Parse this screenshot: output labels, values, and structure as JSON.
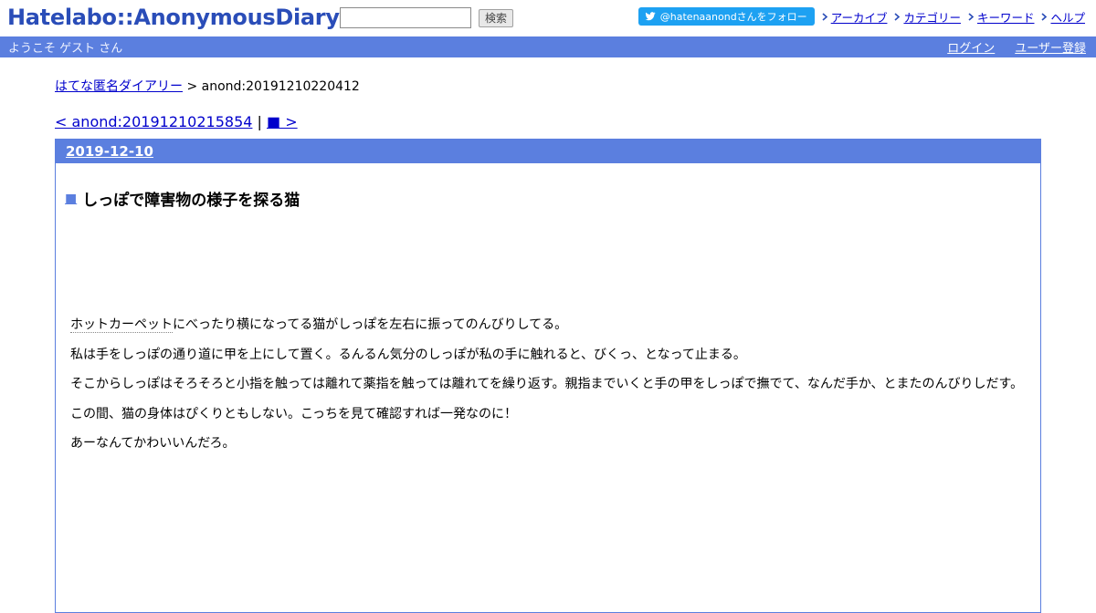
{
  "header": {
    "logo": "Hatelabo::AnonymousDiary",
    "search": {
      "value": "",
      "placeholder": "",
      "button_label": "検索"
    },
    "twitter_follow": "@hatenaanondさんをフォロー",
    "nav": [
      "アーカイブ",
      "カテゴリー",
      "キーワード",
      "ヘルプ"
    ]
  },
  "user_bar": {
    "welcome": "ようこそ ゲスト さん",
    "login": "ログイン",
    "signup": "ユーザー登録"
  },
  "breadcrumb": {
    "root": "はてな匿名ダイアリー",
    "separator": ">",
    "current": "anond:20191210220412"
  },
  "pager": {
    "prev": "< anond:20191210215854",
    "separator": "|",
    "next": "■ >"
  },
  "entry": {
    "date": "2019-12-10",
    "marker": "■",
    "title": "しっぽで障害物の様子を探る猫",
    "paragraphs": [
      "ホットカーペットにべったり横になってる猫がしっぽを左右に振ってのんびりしてる。",
      "私は手をしっぽの通り道に甲を上にして置く。るんるん気分のしっぽが私の手に触れると、びくっ、となって止まる。",
      "そこからしっぽはそろそろと小指を触っては離れて薬指を触っては離れてを繰り返す。親指までいくと手の甲をしっぽで撫でて、なんだ手か、とまたのんびりしだす。",
      "この間、猫の身体はぴくりともしない。こっちを見て確認すれば一発なのに！",
      "あーなんてかわいいんだろ。"
    ]
  },
  "colors": {
    "accent": "#5b7fdf",
    "logo": "#2a4db8",
    "twitter": "#1da1f2",
    "link": "#0000cc"
  }
}
